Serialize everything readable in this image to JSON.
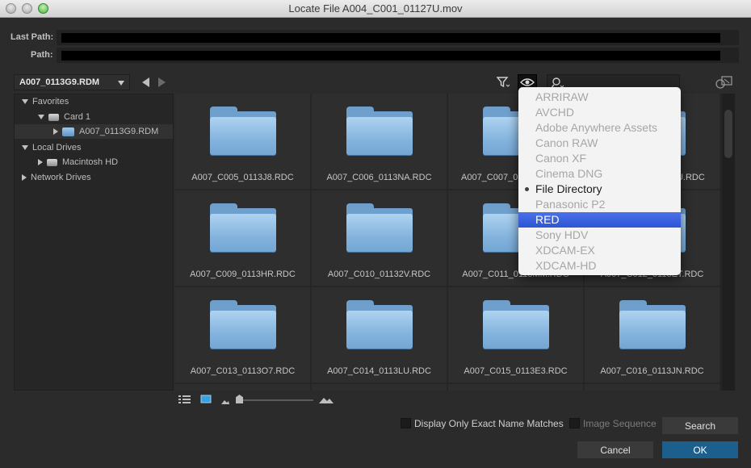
{
  "window": {
    "title": "Locate File A004_C001_01127U.mov"
  },
  "paths": {
    "last_label": "Last Path:",
    "path_label": "Path:"
  },
  "toolbar": {
    "location": "A007_0113G9.RDM"
  },
  "sidebar": {
    "items": [
      {
        "label": "Favorites"
      },
      {
        "label": "Card 1"
      },
      {
        "label": "A007_0113G9.RDM"
      },
      {
        "label": "Local Drives"
      },
      {
        "label": "Macintosh HD"
      },
      {
        "label": "Network Drives"
      }
    ]
  },
  "grid": {
    "folders": [
      {
        "label": "A007_C005_0113J8.RDC"
      },
      {
        "label": "A007_C006_0113NA.RDC"
      },
      {
        "label": "A007_C007_0"
      },
      {
        "label": "A007_C008_0113DU.RDC"
      },
      {
        "label": "A007_C009_0113HR.RDC"
      },
      {
        "label": "A007_C010_01132V.RDC"
      },
      {
        "label": "A007_C011_0113MM.RDC"
      },
      {
        "label": "A007_C012_0113ET.RDC"
      },
      {
        "label": "A007_C013_0113O7.RDC"
      },
      {
        "label": "A007_C014_0113LU.RDC"
      },
      {
        "label": "A007_C015_0113E3.RDC"
      },
      {
        "label": "A007_C016_0113JN.RDC"
      }
    ]
  },
  "menu": {
    "items": [
      {
        "label": "ARRIRAW"
      },
      {
        "label": "AVCHD"
      },
      {
        "label": "Adobe Anywhere Assets"
      },
      {
        "label": "Canon RAW"
      },
      {
        "label": "Canon XF"
      },
      {
        "label": "Cinema DNG"
      },
      {
        "label": "File Directory"
      },
      {
        "label": "Panasonic P2"
      },
      {
        "label": "RED"
      },
      {
        "label": "Sony HDV"
      },
      {
        "label": "XDCAM-EX"
      },
      {
        "label": "XDCAM-HD"
      }
    ],
    "checked": "File Directory",
    "highlighted": "RED"
  },
  "footer": {
    "exact_match_label": "Display Only Exact Name Matches",
    "image_sequence_label": "Image Sequence",
    "search_label": "Search",
    "cancel_label": "Cancel",
    "ok_label": "OK"
  },
  "colors": {
    "accent": "#1d5f8c",
    "menu_highlight": "#3b63e0",
    "folder": "#8ebbe4"
  }
}
